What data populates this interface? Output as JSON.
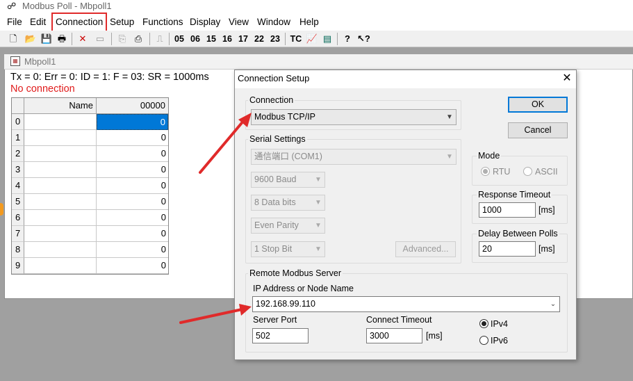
{
  "app": {
    "title": "Modbus Poll - Mbpoll1",
    "icon": "app-icon"
  },
  "menu": [
    "File",
    "Edit",
    "Connection",
    "Setup",
    "Functions",
    "Display",
    "View",
    "Window",
    "Help"
  ],
  "toolbar": {
    "codes": [
      "05",
      "06",
      "15",
      "16",
      "17",
      "22",
      "23"
    ],
    "tc": "TC"
  },
  "child": {
    "title": "Mbpoll1",
    "status": "Tx = 0: Err = 0: ID = 1: F = 03: SR = 1000ms",
    "connection": "No connection",
    "grid": {
      "headers": [
        "Name",
        "00000"
      ],
      "rows": [
        {
          "idx": "0",
          "name": "",
          "value": "0"
        },
        {
          "idx": "1",
          "name": "",
          "value": "0"
        },
        {
          "idx": "2",
          "name": "",
          "value": "0"
        },
        {
          "idx": "3",
          "name": "",
          "value": "0"
        },
        {
          "idx": "4",
          "name": "",
          "value": "0"
        },
        {
          "idx": "5",
          "name": "",
          "value": "0"
        },
        {
          "idx": "6",
          "name": "",
          "value": "0"
        },
        {
          "idx": "7",
          "name": "",
          "value": "0"
        },
        {
          "idx": "8",
          "name": "",
          "value": "0"
        },
        {
          "idx": "9",
          "name": "",
          "value": "0"
        }
      ]
    }
  },
  "dialog": {
    "title": "Connection Setup",
    "close": "✕",
    "ok": "OK",
    "cancel": "Cancel",
    "connection_label": "Connection",
    "connection_value": "Modbus TCP/IP",
    "serial_label": "Serial Settings",
    "port": "通信端口 (COM1)",
    "baud": "9600 Baud",
    "data_bits": "8 Data bits",
    "parity": "Even Parity",
    "stop_bits": "1 Stop Bit",
    "advanced": "Advanced...",
    "mode_label": "Mode",
    "mode_rtu": "RTU",
    "mode_ascii": "ASCII",
    "response_timeout_label": "Response Timeout",
    "response_timeout": "1000",
    "ms": "[ms]",
    "delay_label": "Delay Between Polls",
    "delay": "20",
    "remote_label": "Remote Modbus Server",
    "ip_label": "IP Address or Node Name",
    "ip": "192.168.99.110",
    "port_label": "Server Port",
    "server_port": "502",
    "connect_timeout_label": "Connect Timeout",
    "connect_timeout": "3000",
    "ipv4": "IPv4",
    "ipv6": "IPv6"
  },
  "colors": {
    "highlight": "#e02a2a",
    "error_text": "#e01b1b",
    "selection": "#0078d7"
  }
}
